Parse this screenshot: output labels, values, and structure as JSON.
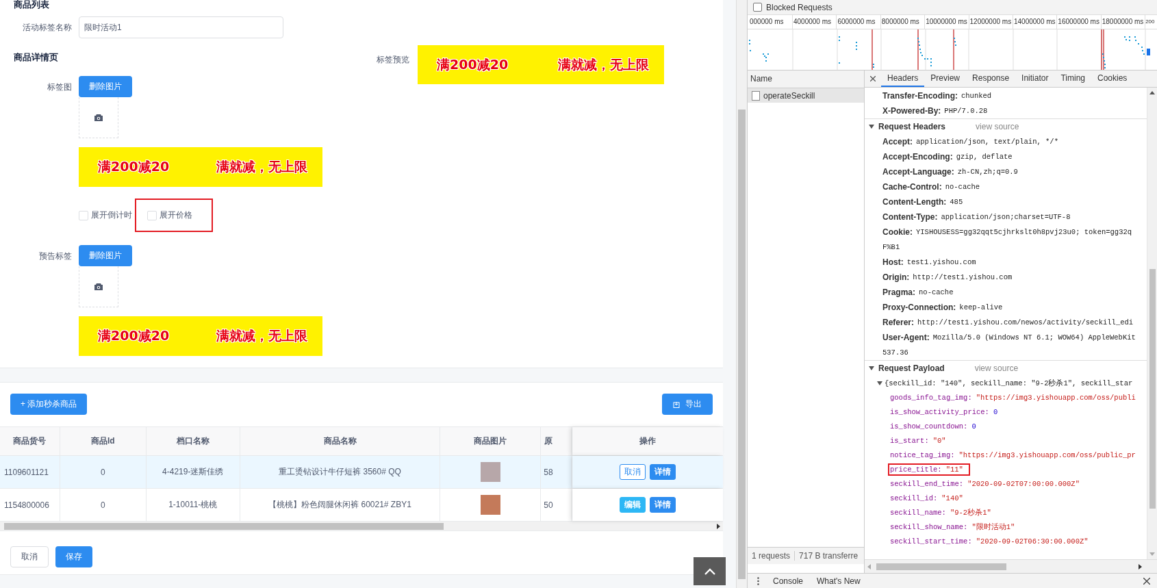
{
  "form": {
    "section_title": "商品列表",
    "name_field": {
      "label": "活动标签名称",
      "value": "限时活动1"
    },
    "detail_heading": "商品详情页",
    "preview": {
      "label": "标签预览",
      "banner": {
        "left": "满200减20",
        "right": "满就减，无上限"
      }
    },
    "tag_image": {
      "label": "标签图",
      "button": "删除图片",
      "banner": {
        "left": "满200减20",
        "right": "满就减，无上限"
      }
    },
    "options": [
      {
        "label": "展开倒计时",
        "checked": false,
        "annotated": false
      },
      {
        "label": "展开价格",
        "checked": false,
        "annotated": true
      }
    ],
    "notice_tag": {
      "label": "预告标签",
      "button": "删除图片",
      "banner": {
        "left": "满200减20",
        "right": "满就减，无上限"
      }
    }
  },
  "goods": {
    "add_button": "+ 添加秒杀商品",
    "export_button": "导出",
    "columns": [
      "商品货号",
      "商品Id",
      "档口名称",
      "商品名称",
      "商品图片",
      "原",
      "操作"
    ],
    "rows": [
      {
        "selected": true,
        "item_no": "1109601121",
        "id": "0",
        "stall": "4-4219-迷斯佳绣",
        "name": "重工烫钻设计牛仔短裤 3560# QQ",
        "price": "58",
        "actions": [
          {
            "label": "取消",
            "kind": "outline"
          },
          {
            "label": "详情",
            "kind": "primary"
          }
        ]
      },
      {
        "selected": false,
        "item_no": "1154800006",
        "id": "0",
        "stall": "1-10011-桃桃",
        "name": "【桃桃】粉色阔腿休闲裤 60021# ZBY1",
        "price": "50",
        "actions": [
          {
            "label": "编辑",
            "kind": "info"
          },
          {
            "label": "详情",
            "kind": "primary"
          }
        ]
      }
    ],
    "cancel_button": "取消",
    "save_button": "保存"
  },
  "devtools": {
    "blocked": {
      "label": "Blocked Requests",
      "checked": false
    },
    "overview_ticks": [
      "000000 ms",
      "4000000 ms",
      "6000000 ms",
      "8000000 ms",
      "10000000 ms",
      "12000000 ms",
      "14000000 ms",
      "16000000 ms",
      "18000000 ms",
      "200"
    ],
    "name_header": "Name",
    "requests": [
      {
        "name": "operateSeckill",
        "selected": true
      }
    ],
    "status": [
      "1 requests",
      "717 B transferre"
    ],
    "tabs": [
      {
        "label": "Headers",
        "selected": true
      },
      {
        "label": "Preview",
        "selected": false
      },
      {
        "label": "Response",
        "selected": false
      },
      {
        "label": "Initiator",
        "selected": false
      },
      {
        "label": "Timing",
        "selected": false
      },
      {
        "label": "Cookies",
        "selected": false
      }
    ],
    "response_tail": [
      {
        "name": "Transfer-Encoding:",
        "value": "chunked"
      },
      {
        "name": "X-Powered-By:",
        "value": "PHP/7.0.28"
      }
    ],
    "request_headers": {
      "title": "Request Headers",
      "link": "view source",
      "expanded": true,
      "items": [
        {
          "name": "Accept:",
          "value": "application/json, text/plain, */*"
        },
        {
          "name": "Accept-Encoding:",
          "value": "gzip, deflate"
        },
        {
          "name": "Accept-Language:",
          "value": "zh-CN,zh;q=0.9"
        },
        {
          "name": "Cache-Control:",
          "value": "no-cache"
        },
        {
          "name": "Content-Length:",
          "value": "485"
        },
        {
          "name": "Content-Type:",
          "value": "application/json;charset=UTF-8"
        },
        {
          "name": "Cookie:",
          "value": "YISHOUSESS=gg32qqt5cjhrkslt0h8pvj23u0; token=gg32q",
          "wrap": "F%B1"
        },
        {
          "name": "Host:",
          "value": "test1.yishou.com"
        },
        {
          "name": "Origin:",
          "value": "http://test1.yishou.com"
        },
        {
          "name": "Pragma:",
          "value": "no-cache"
        },
        {
          "name": "Proxy-Connection:",
          "value": "keep-alive"
        },
        {
          "name": "Referer:",
          "value": "http://test1.yishou.com/newos/activity/seckill_edi"
        },
        {
          "name": "User-Agent:",
          "value": "Mozilla/5.0 (Windows NT 6.1; WOW64) AppleWebKit",
          "wrap": "537.36"
        }
      ]
    },
    "payload": {
      "title": "Request Payload",
      "link": "view source",
      "expanded": true,
      "summary": "{seckill_id: \"140\", seckill_name: \"9-2秒杀1\", seckill_star",
      "summary_expanded": true,
      "fields": [
        {
          "key": "goods_info_tag_img:",
          "value": "\"https://img3.yishouapp.com/oss/publi",
          "kind": "string",
          "annotated": false
        },
        {
          "key": "is_show_activity_price:",
          "value": "0",
          "kind": "number",
          "annotated": false
        },
        {
          "key": "is_show_countdown:",
          "value": "0",
          "kind": "number",
          "annotated": false
        },
        {
          "key": "is_start:",
          "value": "\"0\"",
          "kind": "string",
          "annotated": false
        },
        {
          "key": "notice_tag_img:",
          "value": "\"https://img3.yishouapp.com/oss/public_pr",
          "kind": "string",
          "annotated": false
        },
        {
          "key": "price_title:",
          "value": "\"11\"",
          "kind": "string",
          "annotated": true
        },
        {
          "key": "seckill_end_time:",
          "value": "\"2020-09-02T07:00:00.000Z\"",
          "kind": "string",
          "annotated": false
        },
        {
          "key": "seckill_id:",
          "value": "\"140\"",
          "kind": "string",
          "annotated": false
        },
        {
          "key": "seckill_name:",
          "value": "\"9-2秒杀1\"",
          "kind": "string",
          "annotated": false
        },
        {
          "key": "seckill_show_name:",
          "value": "\"限时活动1\"",
          "kind": "string",
          "annotated": false
        },
        {
          "key": "seckill_start_time:",
          "value": "\"2020-09-02T06:30:00.000Z\"",
          "kind": "string",
          "annotated": false
        }
      ]
    },
    "drawer_tabs": [
      "Console",
      "What's New"
    ]
  }
}
